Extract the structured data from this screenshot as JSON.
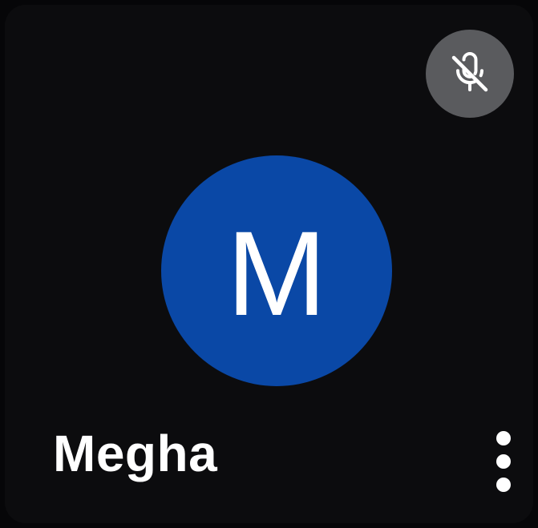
{
  "participant": {
    "name": "Megha",
    "initial": "M",
    "avatar_color": "#0a48a6",
    "muted": true
  },
  "icons": {
    "mute": "microphone-off-icon",
    "more": "more-vert-icon"
  },
  "colors": {
    "tile_background": "#0c0c0e",
    "mute_badge": "#5a5b5e",
    "text": "#ffffff"
  }
}
